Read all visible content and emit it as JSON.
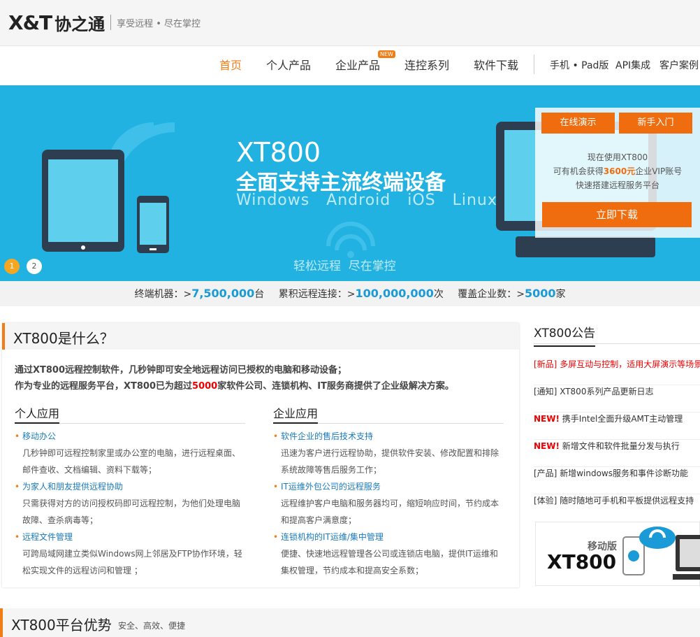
{
  "brand": {
    "logo_latin": "X&T",
    "logo_cn": "协之通",
    "tagline": "享受远程 • 尽在掌控"
  },
  "nav": {
    "items": [
      "首页",
      "个人产品",
      "企业产品",
      "连控系列",
      "软件下载"
    ],
    "new_badge": "NEW",
    "right_items": [
      "手机 • Pad版",
      "API集成",
      "客户案例"
    ],
    "active_color": "#f07d16"
  },
  "banner": {
    "title": "XT800",
    "subtitle": "全面支持主流终端设备",
    "os_line": "Windows   Android   iOS   Linux",
    "slogan": "轻松远程  尽在掌控",
    "dots": [
      "1",
      "2"
    ],
    "bg_color": "#22b2e2"
  },
  "side_panel": {
    "btn_demo": "在线演示",
    "btn_guide": "新手入门",
    "line1": "现在使用XT800",
    "line2_pre": "可有机会获得",
    "line2_hl": "3600元",
    "line2_post": "企业VIP账号",
    "line3": "快速搭建远程服务平台",
    "download": "立即下载",
    "accent": "#f06d0f"
  },
  "stats": {
    "terminals_label": "终端机器：>",
    "terminals_value": "7,500,000",
    "terminals_unit": "台",
    "connections_label": "累积远程连接：>",
    "connections_value": "100,000,000",
    "connections_unit": "次",
    "companies_label": "覆盖企业数：>",
    "companies_value": "5000",
    "companies_unit": "家"
  },
  "what": {
    "title": "XT800是什么？",
    "intro_line1": "通过XT800远程控制软件，几秒钟即可安全地远程访问已授权的电脑和移动设备；",
    "intro_line2_pre": "作为专业的远程服务平台，XT800已为超过",
    "intro_line2_hl": "5000",
    "intro_line2_post": "家软件公司、连锁机构、IT服务商提供了企业级解决方案。",
    "personal": {
      "heading": "个人应用",
      "items": [
        {
          "title": "移动办公",
          "desc1": "几秒钟即可远程控制家里或办公室的电脑，进行远程桌面、",
          "desc2": "邮件查收、文档编辑、资料下载等；"
        },
        {
          "title": "为家人和朋友提供远程协助",
          "desc1": "只需获得对方的访问授权码即可远程控制，为他们处理电脑",
          "desc2": "故障、查杀病毒等；"
        },
        {
          "title": "远程文件管理",
          "desc1": "可跨局域网建立类似Windows网上邻居及FTP协作环境，轻",
          "desc2": "松实现文件的远程访问和管理 ；"
        }
      ]
    },
    "enterprise": {
      "heading": "企业应用",
      "items": [
        {
          "title": "软件企业的售后技术支持",
          "desc1": "迅速为客户进行远程协助，提供软件安装、修改配置和排除",
          "desc2": "系统故障等售后服务工作；"
        },
        {
          "title": "IT运维外包公司的远程服务",
          "desc1": "远程维护客户电脑和服务器均可，缩短响应时间，节约成本",
          "desc2": "和提高客户满意度；"
        },
        {
          "title": "连锁机构的IT运维/集中管理",
          "desc1": "便捷、快速地远程管理各公司或连锁店电脑，提供IT运维和",
          "desc2": "集权管理，节约成本和提高安全系数；"
        }
      ]
    }
  },
  "announcements": {
    "title": "XT800公告",
    "items": [
      {
        "tag": "[新品]",
        "text": "多屏互动与控制，适用大屏演示等场景",
        "style": "red"
      },
      {
        "tag": "[通知]",
        "text": "XT800系列产品更新日志",
        "style": "normal"
      },
      {
        "tag": "NEW!",
        "text": "携手Intel全面升级AMT主动管理",
        "style": "new"
      },
      {
        "tag": "NEW!",
        "text": "新增文件和软件批量分发与执行",
        "style": "new"
      },
      {
        "tag": "[产品]",
        "text": "新增windows服务和事件诊断功能",
        "style": "normal"
      },
      {
        "tag": "[体验]",
        "text": "随时随地可手机和平板提供远程支持",
        "style": "normal"
      }
    ]
  },
  "mobile_ad": {
    "label": "移动版",
    "brand": "XT800"
  },
  "advantages": {
    "title": "XT800平台优势",
    "subtitle": "安全、高效、便捷"
  }
}
